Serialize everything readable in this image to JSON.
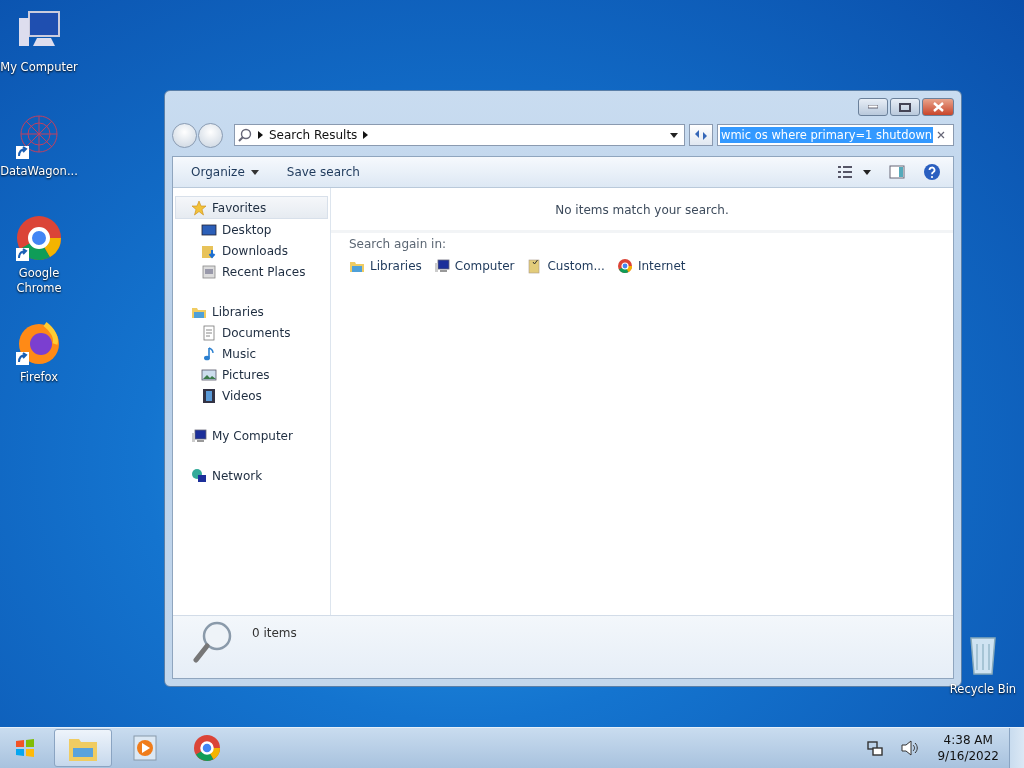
{
  "desktop_icons": [
    {
      "label": "My Computer",
      "kind": "computer",
      "shortcut": false
    },
    {
      "label": "DataWagon...",
      "kind": "datawagon",
      "shortcut": true
    },
    {
      "label": "Google Chrome",
      "kind": "chrome",
      "shortcut": true
    },
    {
      "label": "Firefox",
      "kind": "firefox",
      "shortcut": true
    },
    {
      "label": "Recycle Bin",
      "kind": "recycle",
      "shortcut": false
    }
  ],
  "window": {
    "address": {
      "crumb": "Search Results"
    },
    "search": {
      "value": "wmic os where primary=1 shutdown",
      "selected": true
    },
    "toolbar": [
      {
        "label": "Organize",
        "dropdown": true
      },
      {
        "label": "Save search",
        "dropdown": false
      }
    ],
    "nav": [
      {
        "label": "Favorites",
        "kind": "star",
        "selected": true,
        "children": [
          {
            "label": "Desktop",
            "kind": "desktop"
          },
          {
            "label": "Downloads",
            "kind": "downloads"
          },
          {
            "label": "Recent Places",
            "kind": "recent"
          }
        ]
      },
      {
        "label": "Libraries",
        "kind": "library",
        "selected": false,
        "children": [
          {
            "label": "Documents",
            "kind": "documents"
          },
          {
            "label": "Music",
            "kind": "music"
          },
          {
            "label": "Pictures",
            "kind": "pictures"
          },
          {
            "label": "Videos",
            "kind": "videos"
          }
        ]
      },
      {
        "label": "My Computer",
        "kind": "computer",
        "selected": false
      },
      {
        "label": "Network",
        "kind": "network",
        "selected": false
      }
    ],
    "message": "No items match your search.",
    "search_again": {
      "label": "Search again in:",
      "items": [
        {
          "label": "Libraries",
          "kind": "library"
        },
        {
          "label": "Computer",
          "kind": "computer"
        },
        {
          "label": "Custom...",
          "kind": "custom"
        },
        {
          "label": "Internet",
          "kind": "chrome"
        }
      ]
    },
    "status": {
      "count": "0 items"
    }
  },
  "taskbar": {
    "items": [
      {
        "kind": "explorer",
        "selected": true
      },
      {
        "kind": "media",
        "selected": false
      },
      {
        "kind": "chrome",
        "selected": false
      }
    ],
    "time": "4:38 AM",
    "date": "9/16/2022"
  }
}
